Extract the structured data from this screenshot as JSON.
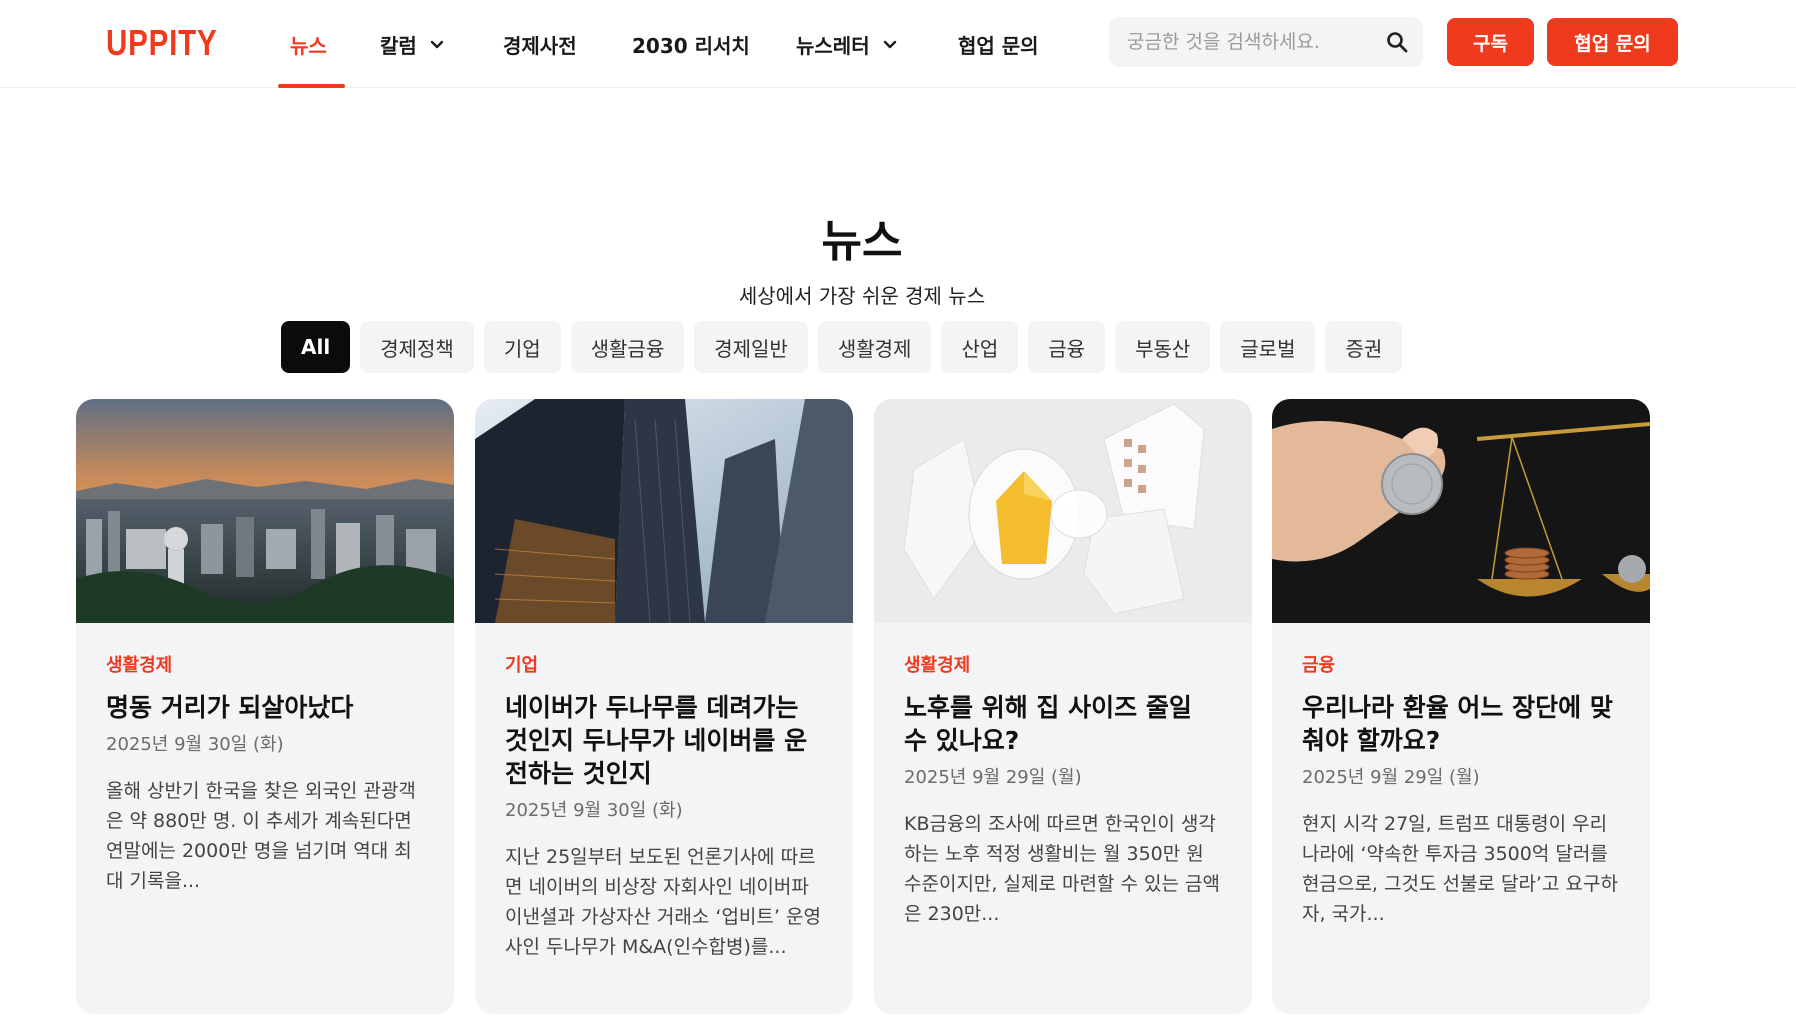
{
  "brand": {
    "logo": "UPPITY",
    "accent": "#f03a1e"
  },
  "nav": {
    "items": [
      {
        "label": "뉴스",
        "active": true,
        "dropdown": false
      },
      {
        "label": "칼럼",
        "active": false,
        "dropdown": true
      },
      {
        "label": "경제사전",
        "active": false,
        "dropdown": false
      },
      {
        "label": "2030 리서치",
        "active": false,
        "dropdown": false
      },
      {
        "label": "뉴스레터",
        "active": false,
        "dropdown": true
      },
      {
        "label": "협업 문의",
        "active": false,
        "dropdown": false
      }
    ]
  },
  "search": {
    "placeholder": "궁금한 것을 검색하세요.",
    "icon": "search-icon"
  },
  "buttons": {
    "subscribe": "구독",
    "collab": "협업 문의"
  },
  "hero": {
    "title": "뉴스",
    "subtitle": "세상에서 가장 쉬운 경제 뉴스"
  },
  "categories": [
    "All",
    "경제정책",
    "기업",
    "생활금융",
    "경제일반",
    "생활경제",
    "산업",
    "금융",
    "부동산",
    "글로벌",
    "증권"
  ],
  "active_category": "All",
  "articles": [
    {
      "category": "생활경제",
      "title": "명동 거리가 되살아났다",
      "date": "2025년 9월 30일 (화)",
      "excerpt": "올해 상반기 한국을 찾은 외국인 관광객은 약 880만 명. 이 추세가 계속된다면 연말에는 2000만 명을 넘기며 역대 최대 기록을...",
      "image": "seoul-city-sunset"
    },
    {
      "category": "기업",
      "title": "네이버가 두나무를 데려가는 것인지 두나무가 네이버를 운전하는 것인지",
      "date": "2025년 9월 30일 (화)",
      "excerpt": "지난 25일부터 보도된 언론기사에 따르면 네이버의 비상장 자회사인 네이버파이낸셜과 가상자산 거래소 ‘업비트’ 운영사인 두나무가 M&A(인수합병)를...",
      "image": "skyscrapers-looking-up"
    },
    {
      "category": "생활경제",
      "title": "노후를 위해 집 사이즈 줄일 수 있나요?",
      "date": "2025년 9월 29일 (월)",
      "excerpt": "KB금융의 조사에 따르면 한국인이 생각하는 노후 적정 생활비는 월 350만 원 수준이지만, 실제로 마련할 수 있는 금액은 230만...",
      "image": "paper-houses"
    },
    {
      "category": "금융",
      "title": "우리나라 환율 어느 장단에 맞춰야 할까요?",
      "date": "2025년 9월 29일 (월)",
      "excerpt": "현지 시각 27일, 트럼프 대통령이 우리나라에 ‘약속한 투자금 3500억 달러를 현금으로, 그것도 선불로 달라’고 요구하자, 국가...",
      "image": "coin-and-scale"
    }
  ]
}
